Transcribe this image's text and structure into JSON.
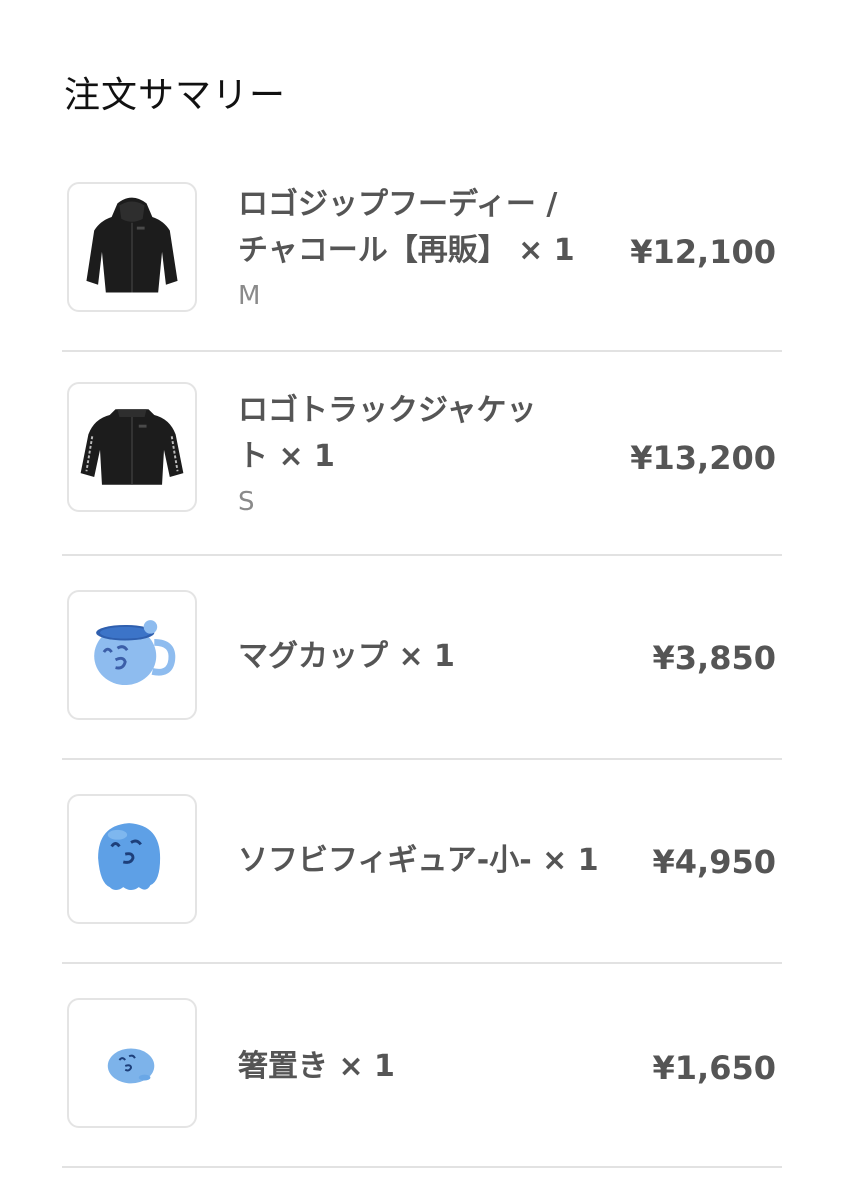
{
  "summary": {
    "title": "注文サマリー"
  },
  "items": [
    {
      "name_line1": "ロゴジップフーディー /",
      "name_line2": "チャコール【再販】 × 1",
      "variant": "M",
      "price": "¥12,100",
      "image": "hoodie-image"
    },
    {
      "name_line1": "ロゴトラックジャケッ",
      "name_line2": "ト × 1",
      "variant": "S",
      "price": "¥13,200",
      "image": "jacket-image"
    },
    {
      "name_line1": "マグカップ × 1",
      "price": "¥3,850",
      "image": "mug-image"
    },
    {
      "name_line1": "ソフビフィギュア-小- × 1",
      "price": "¥4,950",
      "image": "figure-image"
    },
    {
      "name_line1": "箸置き × 1",
      "price": "¥1,650",
      "image": "chopstick-rest-image"
    }
  ],
  "colors": {
    "product_black": "#1c1c1c",
    "product_blue": "#6aa7e6",
    "divider": "#e2e2e2"
  }
}
